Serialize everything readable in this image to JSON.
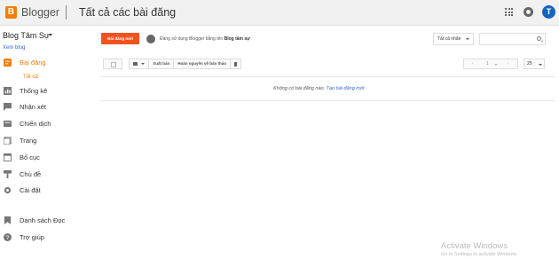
{
  "header": {
    "logo_letter": "B",
    "brand": "Blogger",
    "title": "Tất cả các bài đăng",
    "avatar_letter": "T"
  },
  "sidebar": {
    "blog_name": "Blog Tâm Sự",
    "view_blog": "Xem blog",
    "items": [
      {
        "label": "Bài đăng",
        "icon": "posts-icon"
      },
      {
        "label": "Thống kê",
        "icon": "stats-icon"
      },
      {
        "label": "Nhận xét",
        "icon": "comments-icon"
      },
      {
        "label": "Chiến dịch",
        "icon": "campaigns-icon"
      },
      {
        "label": "Trang",
        "icon": "pages-icon"
      },
      {
        "label": "Bố cục",
        "icon": "layout-icon"
      },
      {
        "label": "Chủ đề",
        "icon": "theme-icon"
      },
      {
        "label": "Cài đặt",
        "icon": "settings-icon"
      },
      {
        "label": "Danh sách Đọc",
        "icon": "reading-list-icon"
      },
      {
        "label": "Trợ giúp",
        "icon": "help-icon"
      }
    ],
    "sub_item": "Tất cả"
  },
  "toolbar": {
    "new_post": "Bài đăng mới",
    "profile_prefix": "Đang sử dụng Blogger bằng tên ",
    "profile_name": "Blog tâm sự",
    "filter": "Tất cả nhãn"
  },
  "actions": {
    "publish": "Xuất bản",
    "revert": "Hoàn nguyên về bản thảo",
    "pager_current": "1",
    "per_page": "25"
  },
  "empty": {
    "message": "Không có bài đăng nào. ",
    "link": "Tạo bài đăng mới"
  },
  "watermark": {
    "title": "Activate Windows",
    "subtitle": "Go to Settings to activate Windows."
  },
  "colors": {
    "accent": "#f57d00",
    "new_post_button": "#f4511e",
    "link": "#3367d6"
  }
}
